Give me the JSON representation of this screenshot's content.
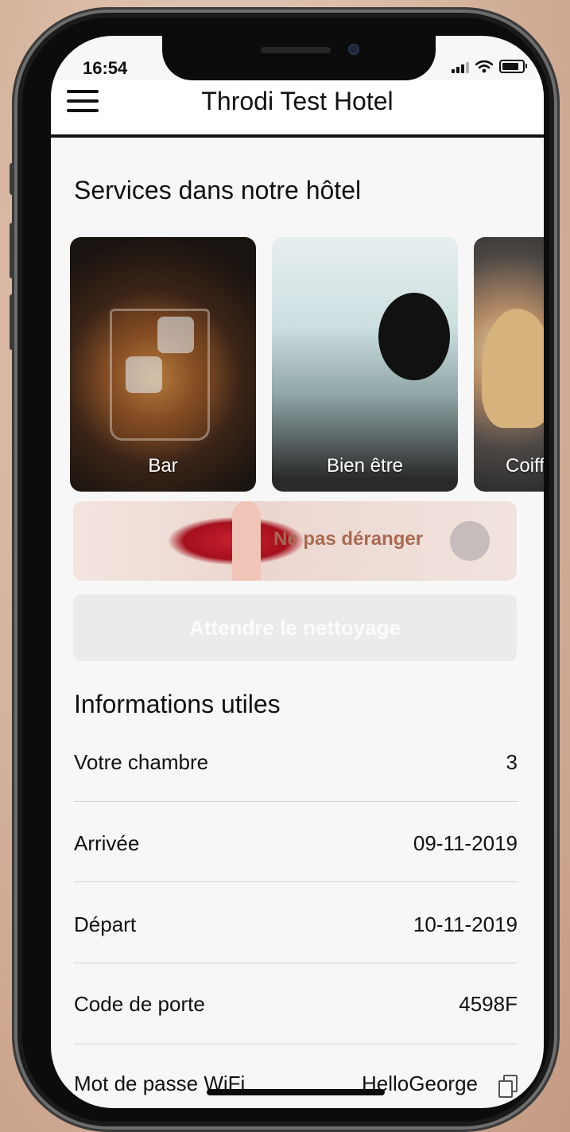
{
  "status_bar": {
    "time": "16:54"
  },
  "header": {
    "title": "Throdi Test Hotel"
  },
  "services": {
    "title": "Services dans notre hôtel",
    "items": [
      {
        "label": "Bar"
      },
      {
        "label": "Bien être"
      },
      {
        "label": "Coiff"
      }
    ]
  },
  "do_not_disturb": {
    "label": "Ne pas déranger",
    "enabled": false
  },
  "cleaning": {
    "label": "Attendre le nettoyage"
  },
  "info": {
    "title": "Informations utiles",
    "rows": [
      {
        "label": "Votre chambre",
        "value": "3"
      },
      {
        "label": "Arrivée",
        "value": "09-11-2019"
      },
      {
        "label": "Départ",
        "value": "10-11-2019"
      },
      {
        "label": "Code de porte",
        "value": "4598F"
      },
      {
        "label": "Mot de passe WiFi",
        "value": "HelloGeorge"
      }
    ]
  },
  "colors": {
    "dnd_label": "#a86a50",
    "clean_button_bg": "#ebebeb",
    "header_border": "#111111"
  }
}
